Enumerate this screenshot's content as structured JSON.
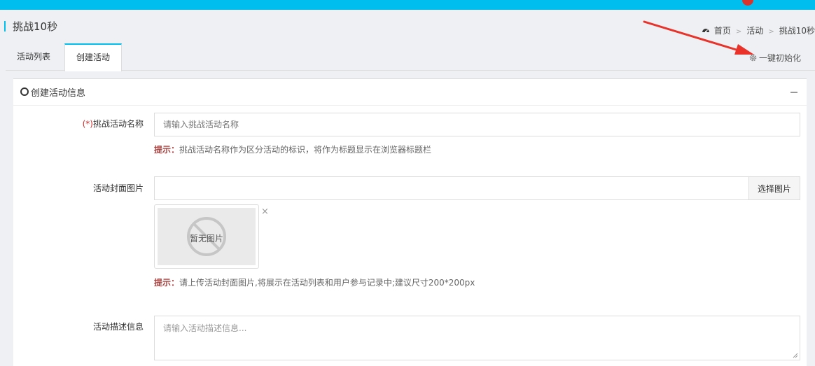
{
  "header": {
    "page_title": "挑战10秒",
    "breadcrumb": [
      "首页",
      "活动",
      "挑战10秒"
    ],
    "breadcrumb_sep": ">"
  },
  "tabs": [
    {
      "label": "活动列表",
      "active": false
    },
    {
      "label": "创建活动",
      "active": true
    }
  ],
  "toolbar": {
    "reset_label": "一键初始化",
    "reset_icon": "gear-icon"
  },
  "panel": {
    "title": "创建活动信息"
  },
  "form": {
    "name": {
      "required_mark": "(*)",
      "label": "挑战活动名称",
      "placeholder": "请输入挑战活动名称",
      "hint_key": "提示：",
      "hint_text": "挑战活动名称作为区分活动的标识，将作为标题显示在浏览器标题栏"
    },
    "cover": {
      "label": "活动封面图片",
      "value": "",
      "choose_label": "选择图片",
      "no_image_text": "暂无图片",
      "remove_label": "×",
      "hint_key": "提示：",
      "hint_text": "请上传活动封面图片,将展示在活动列表和用户参与记录中;建议尺寸200*200px"
    },
    "description": {
      "label": "活动描述信息",
      "placeholder": "请输入活动描述信息..."
    }
  },
  "colors": {
    "accent": "#00bfee",
    "required": "#c9302c",
    "hint_key": "#a94442",
    "annotation_arrow": "#e8322a"
  }
}
